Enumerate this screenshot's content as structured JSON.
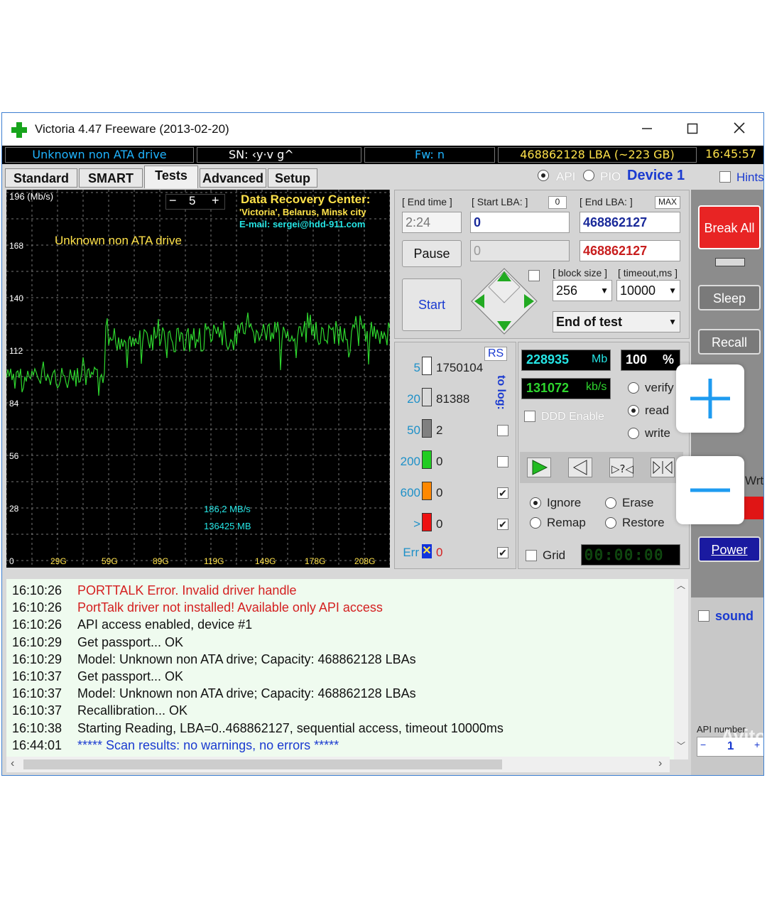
{
  "window": {
    "title": "Victoria 4.47  Freeware (2013-02-20)"
  },
  "status": {
    "drive": "Unknown non ATA drive",
    "sn": "SN:  ‹y·v         g^",
    "fw": "Fw:  n",
    "lba": "468862128 LBA (~223 GB)",
    "clock": "16:45:57"
  },
  "tabs": [
    "Standard",
    "SMART",
    "Tests",
    "Advanced",
    "Setup"
  ],
  "mode": {
    "api": "API",
    "pio": "PIO",
    "device": "Device 1",
    "hints": "Hints"
  },
  "graph": {
    "unit": "196 (Mb/s)",
    "scale_value": "5",
    "header": "Data Recovery Center:",
    "sub1": "'Victoria', Belarus, Minsk city",
    "sub2": "E-mail: sergei@hdd-911.com",
    "drive": "Unknown non ATA drive",
    "yticks": [
      "168",
      "140",
      "112",
      "84",
      "56",
      "28",
      "0"
    ],
    "xticks": [
      "29G",
      "59G",
      "89G",
      "119G",
      "149G",
      "178G",
      "208G"
    ],
    "speed": "186,2 MB/s",
    "size": "136425 MB",
    "trace_color": "#2ed62e"
  },
  "controls": {
    "end_time_label": "[ End time ]",
    "end_time": "2:24",
    "start_lba_label": "[ Start LBA: ]",
    "start_lba_small": "0",
    "start_lba": "0",
    "end_lba_label": "[ End LBA: ]",
    "max_label": "MAX",
    "end_lba": "468862127",
    "second_start": "0",
    "second_end": "468862127",
    "pause": "Pause",
    "start": "Start",
    "block_size_label": "[ block size ]",
    "timeout_label": "[ timeout,ms ]",
    "block_size": "256",
    "timeout": "10000",
    "end_action": "End of test"
  },
  "stats": {
    "rs": "RS",
    "to_log": "to log:",
    "rows": [
      {
        "label": "5",
        "value": "1750104",
        "color": "#ffffff"
      },
      {
        "label": "20",
        "value": "81388",
        "color": "#d9d9d9"
      },
      {
        "label": "50",
        "value": "2",
        "color": "#808080"
      },
      {
        "label": "200",
        "value": "0",
        "color": "#22cc22"
      },
      {
        "label": "600",
        "value": "0",
        "color": "#ff8800"
      },
      {
        "label": ">",
        "value": "0",
        "color": "#ee1111"
      },
      {
        "label": "Err",
        "value": "0",
        "color": "#1133dd"
      }
    ],
    "mb": "228935",
    "mb_unit": "Mb",
    "pct": "100",
    "pct_unit": "%",
    "kbs": "131072",
    "kbs_unit": "kb/s",
    "ddd": "DDD Enable",
    "verify": "verify",
    "read": "read",
    "write": "write",
    "ignore": "Ignore",
    "erase": "Erase",
    "remap": "Remap",
    "restore": "Restore",
    "grid": "Grid",
    "timer": "00:00:00"
  },
  "right": {
    "break_all": "Break All",
    "sleep": "Sleep",
    "recall": "Recall",
    "wrt": "Wrt",
    "power": "Power",
    "sound": "sound",
    "api_number": "API number",
    "api_value": "1"
  },
  "log": [
    {
      "time": "16:10:26",
      "text": "PORTTALK Error. Invalid driver handle",
      "color": "#d42020"
    },
    {
      "time": "16:10:26",
      "text": "PortTalk driver not installed! Available only API access",
      "color": "#d42020"
    },
    {
      "time": "16:10:26",
      "text": "API access enabled, device #1",
      "color": "#111111"
    },
    {
      "time": "16:10:29",
      "text": "Get passport... OK",
      "color": "#111111"
    },
    {
      "time": "16:10:29",
      "text": "Model: Unknown non ATA drive; Capacity: 468862128 LBAs",
      "color": "#111111"
    },
    {
      "time": "16:10:37",
      "text": "Get passport... OK",
      "color": "#111111"
    },
    {
      "time": "16:10:37",
      "text": "Model: Unknown non ATA drive; Capacity: 468862128 LBAs",
      "color": "#111111"
    },
    {
      "time": "16:10:37",
      "text": "Recallibration... OK",
      "color": "#111111"
    },
    {
      "time": "16:10:38",
      "text": "Starting Reading, LBA=0..468862127, sequential access, timeout 10000ms",
      "color": "#111111"
    },
    {
      "time": "16:44:01",
      "text": "***** Scan results: no warnings, no errors *****",
      "color": "#1a3ad0"
    }
  ],
  "watermark": "Avito"
}
